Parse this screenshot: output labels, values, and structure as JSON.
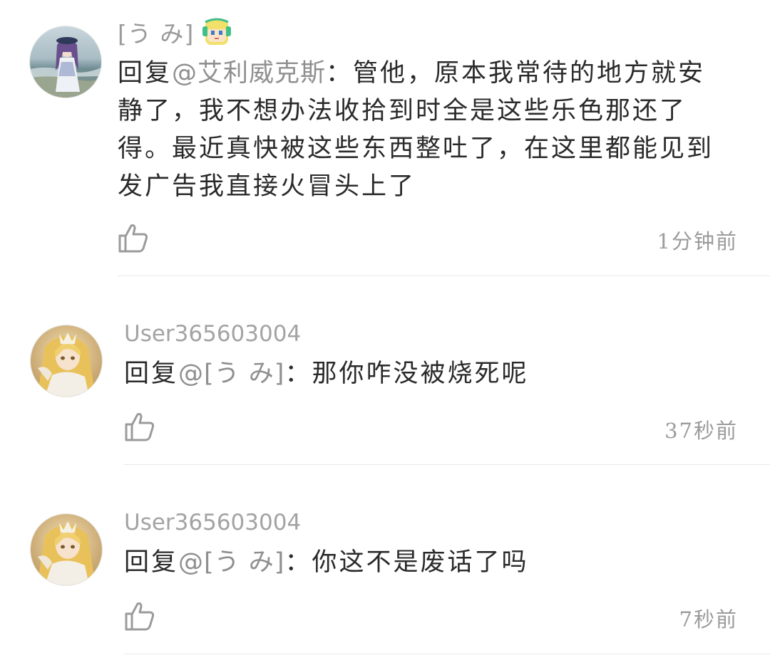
{
  "comments": [
    {
      "username": "[う み]",
      "reply_prefix": "回复",
      "mention": "@艾利威克斯",
      "text_lines": [
        "：管他，原本我常待的地方就安",
        "静了，我不想办法收拾到时全是这些乐色那还了",
        "得。最近真快被这些东西整吐了，在这里都能见到",
        "发广告我直接火冒头上了"
      ],
      "time": "1分钟前"
    },
    {
      "username": "User365603004",
      "reply_prefix": "回复",
      "mention": "@[う み]",
      "text": "：那你咋没被烧死呢",
      "time": "37秒前"
    },
    {
      "username": "User365603004",
      "reply_prefix": "回复",
      "mention": "@[う み]",
      "text": "：你这不是废话了吗",
      "time": "7秒前"
    }
  ],
  "colors": {
    "text": "#2a2a2a",
    "muted": "#9b9b9b",
    "divider": "#e8e8e8"
  },
  "icons": {
    "like": "thumbs-up-icon",
    "badge": "pixel-character-badge-icon"
  }
}
